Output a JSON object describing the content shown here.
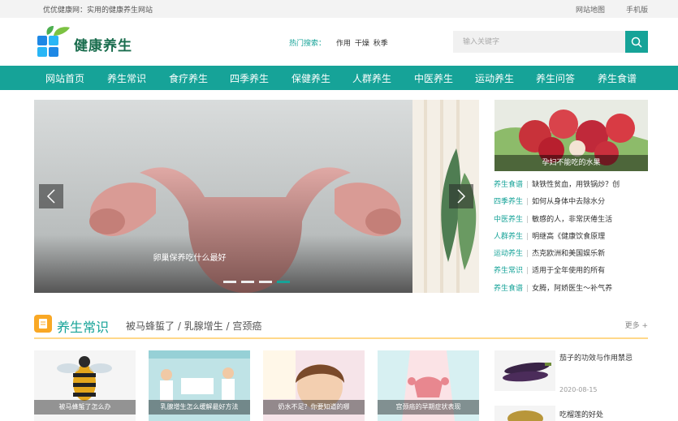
{
  "topbar": {
    "site_desc": "优优健康网：实用的健康养生网站",
    "sitemap": "网站地图",
    "mobile": "手机版"
  },
  "logo": {
    "text": "健康养生"
  },
  "hot_search": {
    "label": "热门搜索：",
    "words": "作用  干燥  秋季"
  },
  "search": {
    "placeholder": "输入关键字"
  },
  "nav": [
    "网站首页",
    "养生常识",
    "食疗养生",
    "四季养生",
    "保健养生",
    "人群养生",
    "中医养生",
    "运动养生",
    "养生问答",
    "养生食谱"
  ],
  "slider": {
    "caption": "卵巢保养吃什么最好",
    "dots": 4,
    "active_dot": 4
  },
  "feature": {
    "caption": "孕妇不能吃的水果"
  },
  "news": [
    {
      "cat": "养生食谱",
      "title": "缺铁性贫血，用铁锅炒？创"
    },
    {
      "cat": "四季养生",
      "title": "如何从身体中去除水分"
    },
    {
      "cat": "中医养生",
      "title": "敏感的人，非常厌倦生活"
    },
    {
      "cat": "人群养生",
      "title": "明继高《健康饮食原理"
    },
    {
      "cat": "运动养生",
      "title": "杰克欧洲和美国娱乐新"
    },
    {
      "cat": "养生常识",
      "title": "适用于全年使用的所有"
    },
    {
      "cat": "养生食谱",
      "title": "女腾，阿娇医生～补气养"
    }
  ],
  "section": {
    "title": "养生常识",
    "tags": "被马蜂蜇了 / 乳腺增生 / 宫颈癌",
    "more": "更多 +"
  },
  "cards": [
    {
      "caption": "被马蜂蜇了怎么办"
    },
    {
      "caption": "乳腺增生怎么缓解最好方法"
    },
    {
      "caption": "奶水不足？你要知道的哪"
    },
    {
      "caption": "宫颈癌的早期症状表现"
    }
  ],
  "side_items": [
    {
      "title": "茄子的功效与作用禁忌",
      "date": "2020-08-15"
    },
    {
      "title": "吃榴莲的好处",
      "date": ""
    }
  ],
  "colors": {
    "accent": "#16a398",
    "section_icon": "#f9a825"
  }
}
